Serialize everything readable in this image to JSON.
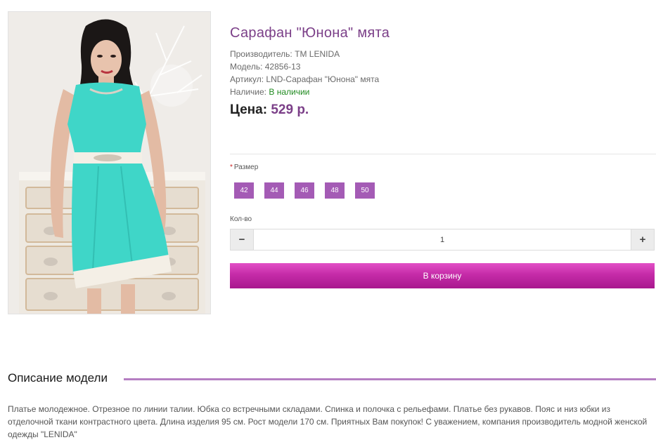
{
  "product": {
    "title": "Сарафан \"Юнона\" мята",
    "manufacturer_label": "Производитель:",
    "manufacturer": "TM LENIDA",
    "model_label": "Модель:",
    "model": "42856-13",
    "sku_label": "Артикул:",
    "sku": "LND-Сарафан \"Юнона\" мята",
    "availability_label": "Наличие:",
    "availability": "В наличии",
    "price_label": "Цена:",
    "price": "529 р."
  },
  "options": {
    "size_required_mark": "*",
    "size_label": "Размер",
    "sizes": [
      "42",
      "44",
      "46",
      "48",
      "50"
    ],
    "qty_label": "Кол-во",
    "qty_value": "1",
    "minus_symbol": "−",
    "plus_symbol": "+"
  },
  "cart": {
    "label": "В корзину"
  },
  "description": {
    "heading": "Описание модели",
    "text": "Платье молодежное. Отрезное по линии талии. Юбка со встречными складами. Спинка и полочка с рельефами. Платье без рукавов. Пояс и низ юбки из отделочной ткани контрастного цвета. Длина изделия 95 см. Рост модели 170 см. Приятных Вам покупок! С уважением, компания производитель модной женской одежды \"LENIDA\""
  },
  "colors": {
    "accent": "#7b3f88",
    "size_button": "#a45bb5",
    "cart_button": "#c52ba8",
    "in_stock": "#1f8a1f",
    "dress": "#3fd6c8"
  }
}
